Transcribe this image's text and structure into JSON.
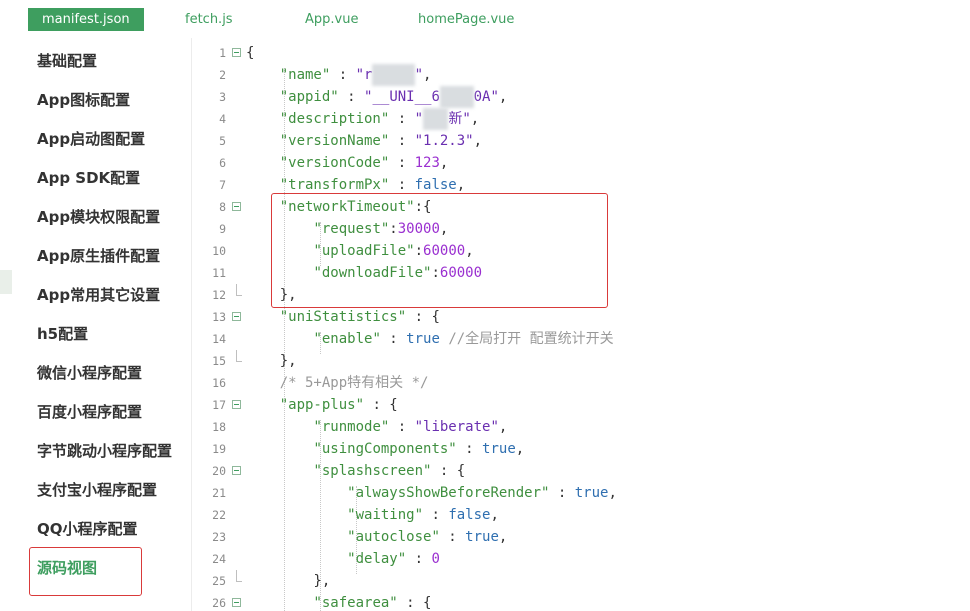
{
  "tabs": [
    {
      "label": "manifest.json",
      "active": true
    },
    {
      "label": "fetch.js",
      "active": false
    },
    {
      "label": "App.vue",
      "active": false
    },
    {
      "label": "homePage.vue",
      "active": false
    }
  ],
  "sidebar": {
    "items": [
      {
        "label": "基础配置"
      },
      {
        "label": "App图标配置"
      },
      {
        "label": "App启动图配置"
      },
      {
        "label": "App SDK配置"
      },
      {
        "label": "App模块权限配置"
      },
      {
        "label": "App原生插件配置"
      },
      {
        "label": "App常用其它设置"
      },
      {
        "label": "h5配置"
      },
      {
        "label": "微信小程序配置"
      },
      {
        "label": "百度小程序配置"
      },
      {
        "label": "字节跳动小程序配置"
      },
      {
        "label": "支付宝小程序配置"
      },
      {
        "label": "QQ小程序配置"
      },
      {
        "label": "源码视图",
        "active": true
      }
    ]
  },
  "editor": {
    "line_numbers": [
      "1",
      "2",
      "3",
      "4",
      "5",
      "6",
      "7",
      "8",
      "9",
      "10",
      "11",
      "12",
      "13",
      "14",
      "15",
      "16",
      "17",
      "18",
      "19",
      "20",
      "21",
      "22",
      "23",
      "24",
      "25",
      "26"
    ],
    "code": {
      "l1_brace": "{",
      "name_key": "\"name\"",
      "name_val_a": "\"r",
      "name_val_b": "\"",
      "appid_key": "\"appid\"",
      "appid_val_a": "\"__UNI__6",
      "appid_val_b": "0A\"",
      "description_key": "\"description\"",
      "description_val_a": "\"",
      "description_val_b": "新\"",
      "versionName_key": "\"versionName\"",
      "versionName_val": "\"1.2.3\"",
      "versionCode_key": "\"versionCode\"",
      "versionCode_val": "123",
      "transformPx_key": "\"transformPx\"",
      "transformPx_val": "false",
      "networkTimeout_key": "\"networkTimeout\"",
      "request_key": "\"request\"",
      "request_val": "30000",
      "uploadFile_key": "\"uploadFile\"",
      "uploadFile_val": "60000",
      "downloadFile_key": "\"downloadFile\"",
      "downloadFile_val": "60000",
      "close_obj_comma": "},",
      "uniStatistics_key": "\"uniStatistics\"",
      "enable_key": "\"enable\"",
      "enable_val": "true",
      "enable_comment": "//全局打开 配置统计开关",
      "comment_5plus": "/* 5+App特有相关 */",
      "appplus_key": "\"app-plus\"",
      "runmode_key": "\"runmode\"",
      "runmode_val": "\"liberate\"",
      "usingComponents_key": "\"usingComponents\"",
      "usingComponents_val": "true",
      "splashscreen_key": "\"splashscreen\"",
      "alwaysShow_key": "\"alwaysShowBeforeRender\"",
      "alwaysShow_val": "true",
      "waiting_key": "\"waiting\"",
      "waiting_val": "false",
      "autoclose_key": "\"autoclose\"",
      "autoclose_val": "true",
      "delay_key": "\"delay\"",
      "delay_val": "0",
      "safearea_key": "\"safearea\""
    }
  },
  "colors": {
    "accent": "#3e9e5f",
    "highlight_border": "#d93a3a",
    "string": "#6a2fb0",
    "number": "#9a2fd0",
    "boolean": "#2f6fb0",
    "comment": "#999999"
  }
}
